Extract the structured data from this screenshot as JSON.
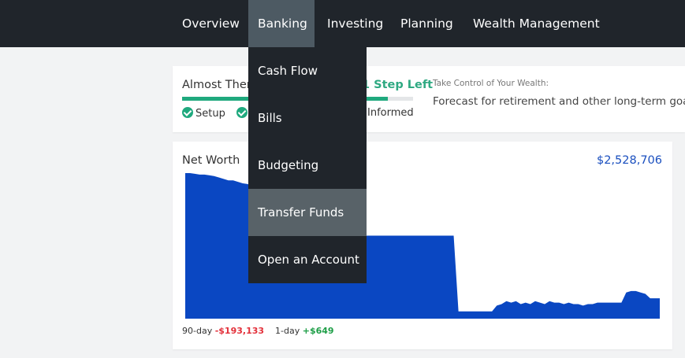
{
  "nav": {
    "items": [
      {
        "label": "Overview"
      },
      {
        "label": "Banking"
      },
      {
        "label": "Investing"
      },
      {
        "label": "Planning"
      },
      {
        "label": "Wealth Management"
      }
    ]
  },
  "banking_menu": {
    "items": [
      {
        "label": "Cash Flow"
      },
      {
        "label": "Bills"
      },
      {
        "label": "Budgeting"
      },
      {
        "label": "Transfer Funds"
      },
      {
        "label": "Open an Account"
      }
    ]
  },
  "progress": {
    "title": "Almost There",
    "steps_left": "1 Step Left",
    "fill": 0.89,
    "steps": [
      "Setup",
      "Informed"
    ]
  },
  "wealth": {
    "subtitle": "Take Control of Your Wealth:",
    "description": "Forecast for retirement and other long-term goals."
  },
  "net_worth": {
    "title": "Net Worth",
    "value": "$2,528,706",
    "period_90_label": "90-day",
    "period_90_value": "-$193,133",
    "period_1_label": "1-day",
    "period_1_value": "+$649"
  },
  "chart_data": {
    "type": "area",
    "values": [
      100,
      100,
      99.5,
      99,
      99,
      98.5,
      98,
      97,
      96,
      95,
      95,
      94,
      93,
      92.5,
      91,
      88,
      84,
      80,
      76,
      73,
      71,
      68,
      66,
      65,
      64,
      63,
      62,
      61,
      60,
      60,
      59,
      59,
      58,
      58,
      58,
      58,
      57,
      57,
      57,
      57,
      57,
      57,
      57,
      57,
      57,
      57,
      57,
      57,
      57,
      57,
      57,
      57,
      57,
      57,
      57,
      57,
      57,
      5,
      5,
      5,
      5,
      5,
      5,
      5,
      5,
      9,
      10,
      12,
      11,
      12,
      10,
      11,
      10,
      12,
      11,
      10,
      12,
      11,
      11,
      10,
      11,
      10,
      10,
      9,
      10,
      10,
      11,
      11,
      11,
      11,
      11,
      11,
      18,
      19,
      19,
      18,
      17,
      14,
      14,
      14
    ],
    "ylim": [
      0,
      100
    ],
    "colors": {
      "fill": "#0a47c2"
    }
  },
  "colors": {
    "nav_bg": "#20252b",
    "accent_green": "#1fa97e",
    "value_blue": "#1a4fbf",
    "negative_red": "#e3313b",
    "positive_green": "#1e9e47"
  }
}
